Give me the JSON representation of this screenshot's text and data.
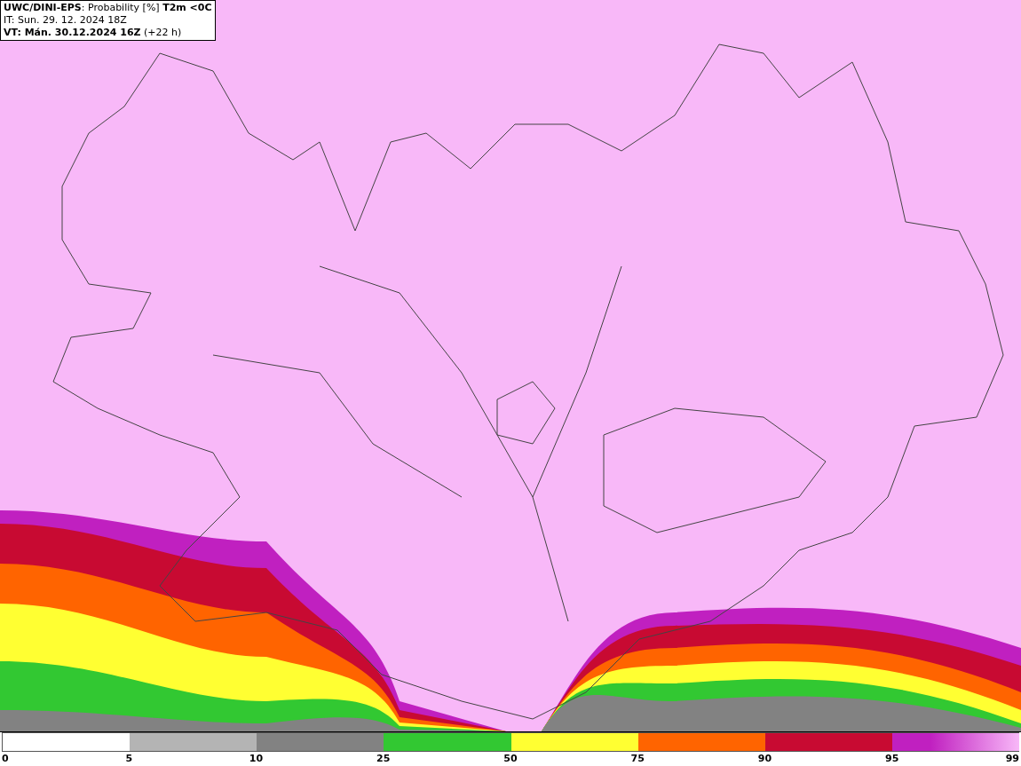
{
  "title_box": {
    "lines": [
      "**UWC/DINI-EPS**: Probability [%] **T2m <0C**",
      "IT: Sun. 29. 12. 2024 18Z",
      "**VT: Mán. 30.12.2024 16Z** (+22 h)"
    ]
  },
  "legend": {
    "segments": [
      {
        "color": "#ffffff"
      },
      {
        "color": "#b4b4b4"
      },
      {
        "color": "#828282"
      },
      {
        "color": "#32c832"
      },
      {
        "color": "#ffff32"
      },
      {
        "color": "#ff6400"
      },
      {
        "color": "#c80a32"
      },
      {
        "color": "#c020c0"
      }
    ],
    "labels": [
      "0",
      "5",
      "10",
      "25",
      "50",
      "75",
      "90",
      "95",
      "99"
    ]
  }
}
